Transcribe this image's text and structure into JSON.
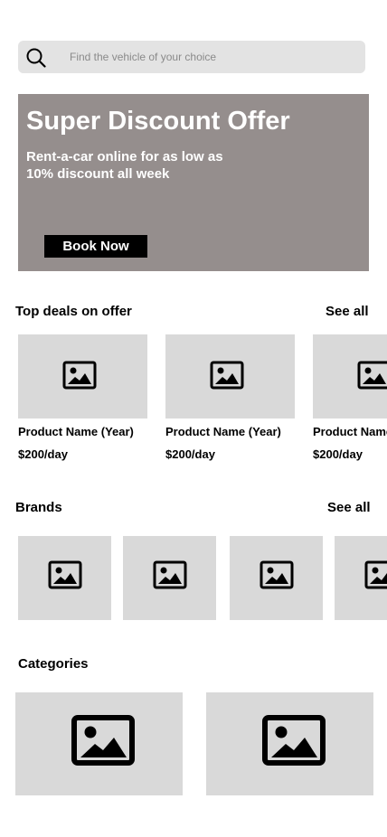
{
  "search": {
    "placeholder": "Find the vehicle of your choice"
  },
  "banner": {
    "title": "Super Discount Offer",
    "subtitle": "Rent-a-car online for as low as 10% discount all week",
    "button_label": "Book Now",
    "background_color": "#958e8d"
  },
  "top_deals": {
    "title": "Top deals on offer",
    "see_all_label": "See all",
    "items": [
      {
        "name": "Product Name (Year)",
        "price": "$200/day",
        "image_icon": "image-placeholder-icon"
      },
      {
        "name": "Product Name (Year)",
        "price": "$200/day",
        "image_icon": "image-placeholder-icon"
      },
      {
        "name": "Product Name (Year)",
        "price": "$200/day",
        "image_icon": "image-placeholder-icon"
      }
    ]
  },
  "brands": {
    "title": "Brands",
    "see_all_label": "See all",
    "items": [
      {
        "image_icon": "image-placeholder-icon"
      },
      {
        "image_icon": "image-placeholder-icon"
      },
      {
        "image_icon": "image-placeholder-icon"
      },
      {
        "image_icon": "image-placeholder-icon"
      }
    ]
  },
  "categories": {
    "title": "Categories",
    "items": [
      {
        "image_icon": "image-placeholder-icon"
      },
      {
        "image_icon": "image-placeholder-icon"
      }
    ]
  },
  "colors": {
    "placeholder_gray": "#d9d9d9",
    "search_bg": "#e3e3e3",
    "button_bg": "#000000"
  }
}
